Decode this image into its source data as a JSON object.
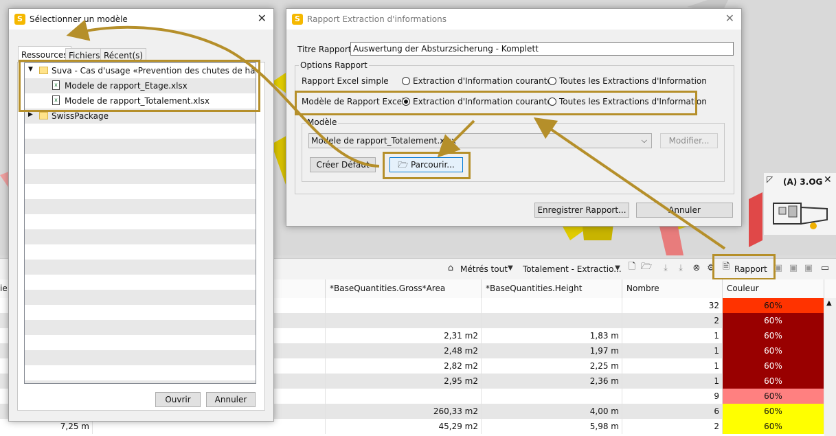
{
  "scene": {
    "level_label": "(A) 3.OG"
  },
  "toolbar": {
    "measured_all": "Métrés tout",
    "extraction_select": "Totalement - Extractio...",
    "report_label": "Rapport"
  },
  "grid": {
    "headers": {
      "col0": "ie",
      "gross_area": "*BaseQuantities.Gross*Area",
      "height": "*BaseQuantities.Height",
      "count": "Nombre",
      "color": "Couleur"
    },
    "rows": [
      {
        "left": "",
        "area": "",
        "height": "",
        "count": "32",
        "color_label": "60%",
        "color": "#ff3300"
      },
      {
        "left": "",
        "area": "",
        "height": "",
        "count": "2",
        "color_label": "60%",
        "color": "#990000"
      },
      {
        "left": "",
        "area": "2,31 m2",
        "height": "1,83 m",
        "count": "1",
        "color_label": "60%",
        "color": "#990000"
      },
      {
        "left": "",
        "area": "2,48 m2",
        "height": "1,97 m",
        "count": "1",
        "color_label": "60%",
        "color": "#990000"
      },
      {
        "left": "",
        "area": "2,82 m2",
        "height": "2,25 m",
        "count": "1",
        "color_label": "60%",
        "color": "#990000"
      },
      {
        "left": "",
        "area": "2,95 m2",
        "height": "2,36 m",
        "count": "1",
        "color_label": "60%",
        "color": "#990000"
      },
      {
        "left": "",
        "area": "",
        "height": "",
        "count": "9",
        "color_label": "60%",
        "color": "#ff8080"
      },
      {
        "left": "",
        "area": "260,33 m2",
        "height": "4,00 m",
        "count": "6",
        "color_label": "60%",
        "color": "#ffff00"
      },
      {
        "left": "7,25 m",
        "area": "45,29 m2",
        "height": "5,98 m",
        "count": "2",
        "color_label": "60%",
        "color": "#ffff00"
      }
    ]
  },
  "select_dialog": {
    "title": "Sélectionner un modèle",
    "tabs": [
      "Ressources",
      "Fichiers",
      "Récent(s)"
    ],
    "tree": {
      "folder1": "Suva - Cas d'usage «Prevention des chutes de hauteur»",
      "file1": "Modele de rapport_Etage.xlsx",
      "file2": "Modele de rapport_Totalement.xlsx",
      "folder2": "SwissPackage"
    },
    "open_button": "Ouvrir",
    "cancel_button": "Annuler"
  },
  "report_dialog": {
    "title": "Rapport Extraction d'informations",
    "title_label": "Titre Rapport",
    "title_value": "Auswertung der Absturzsicherung - Komplett",
    "options_group": "Options Rapport",
    "simple_excel_label": "Rapport Excel simple",
    "template_excel_label": "Modèle de Rapport Excel",
    "option_current": "Extraction d'Information courante",
    "option_all": "Toutes les Extractions d'Information",
    "model_group": "Modèle",
    "model_value": "Modele de rapport_Totalement.xlsx",
    "modify_button": "Modifier...",
    "create_default_button": "Créer Défaut",
    "browse_button": "Parcourir...",
    "save_button": "Enregistrer Rapport...",
    "cancel_button": "Annuler"
  },
  "colors": {
    "highlight": "#b58f2a",
    "accent": "#0078d7"
  }
}
